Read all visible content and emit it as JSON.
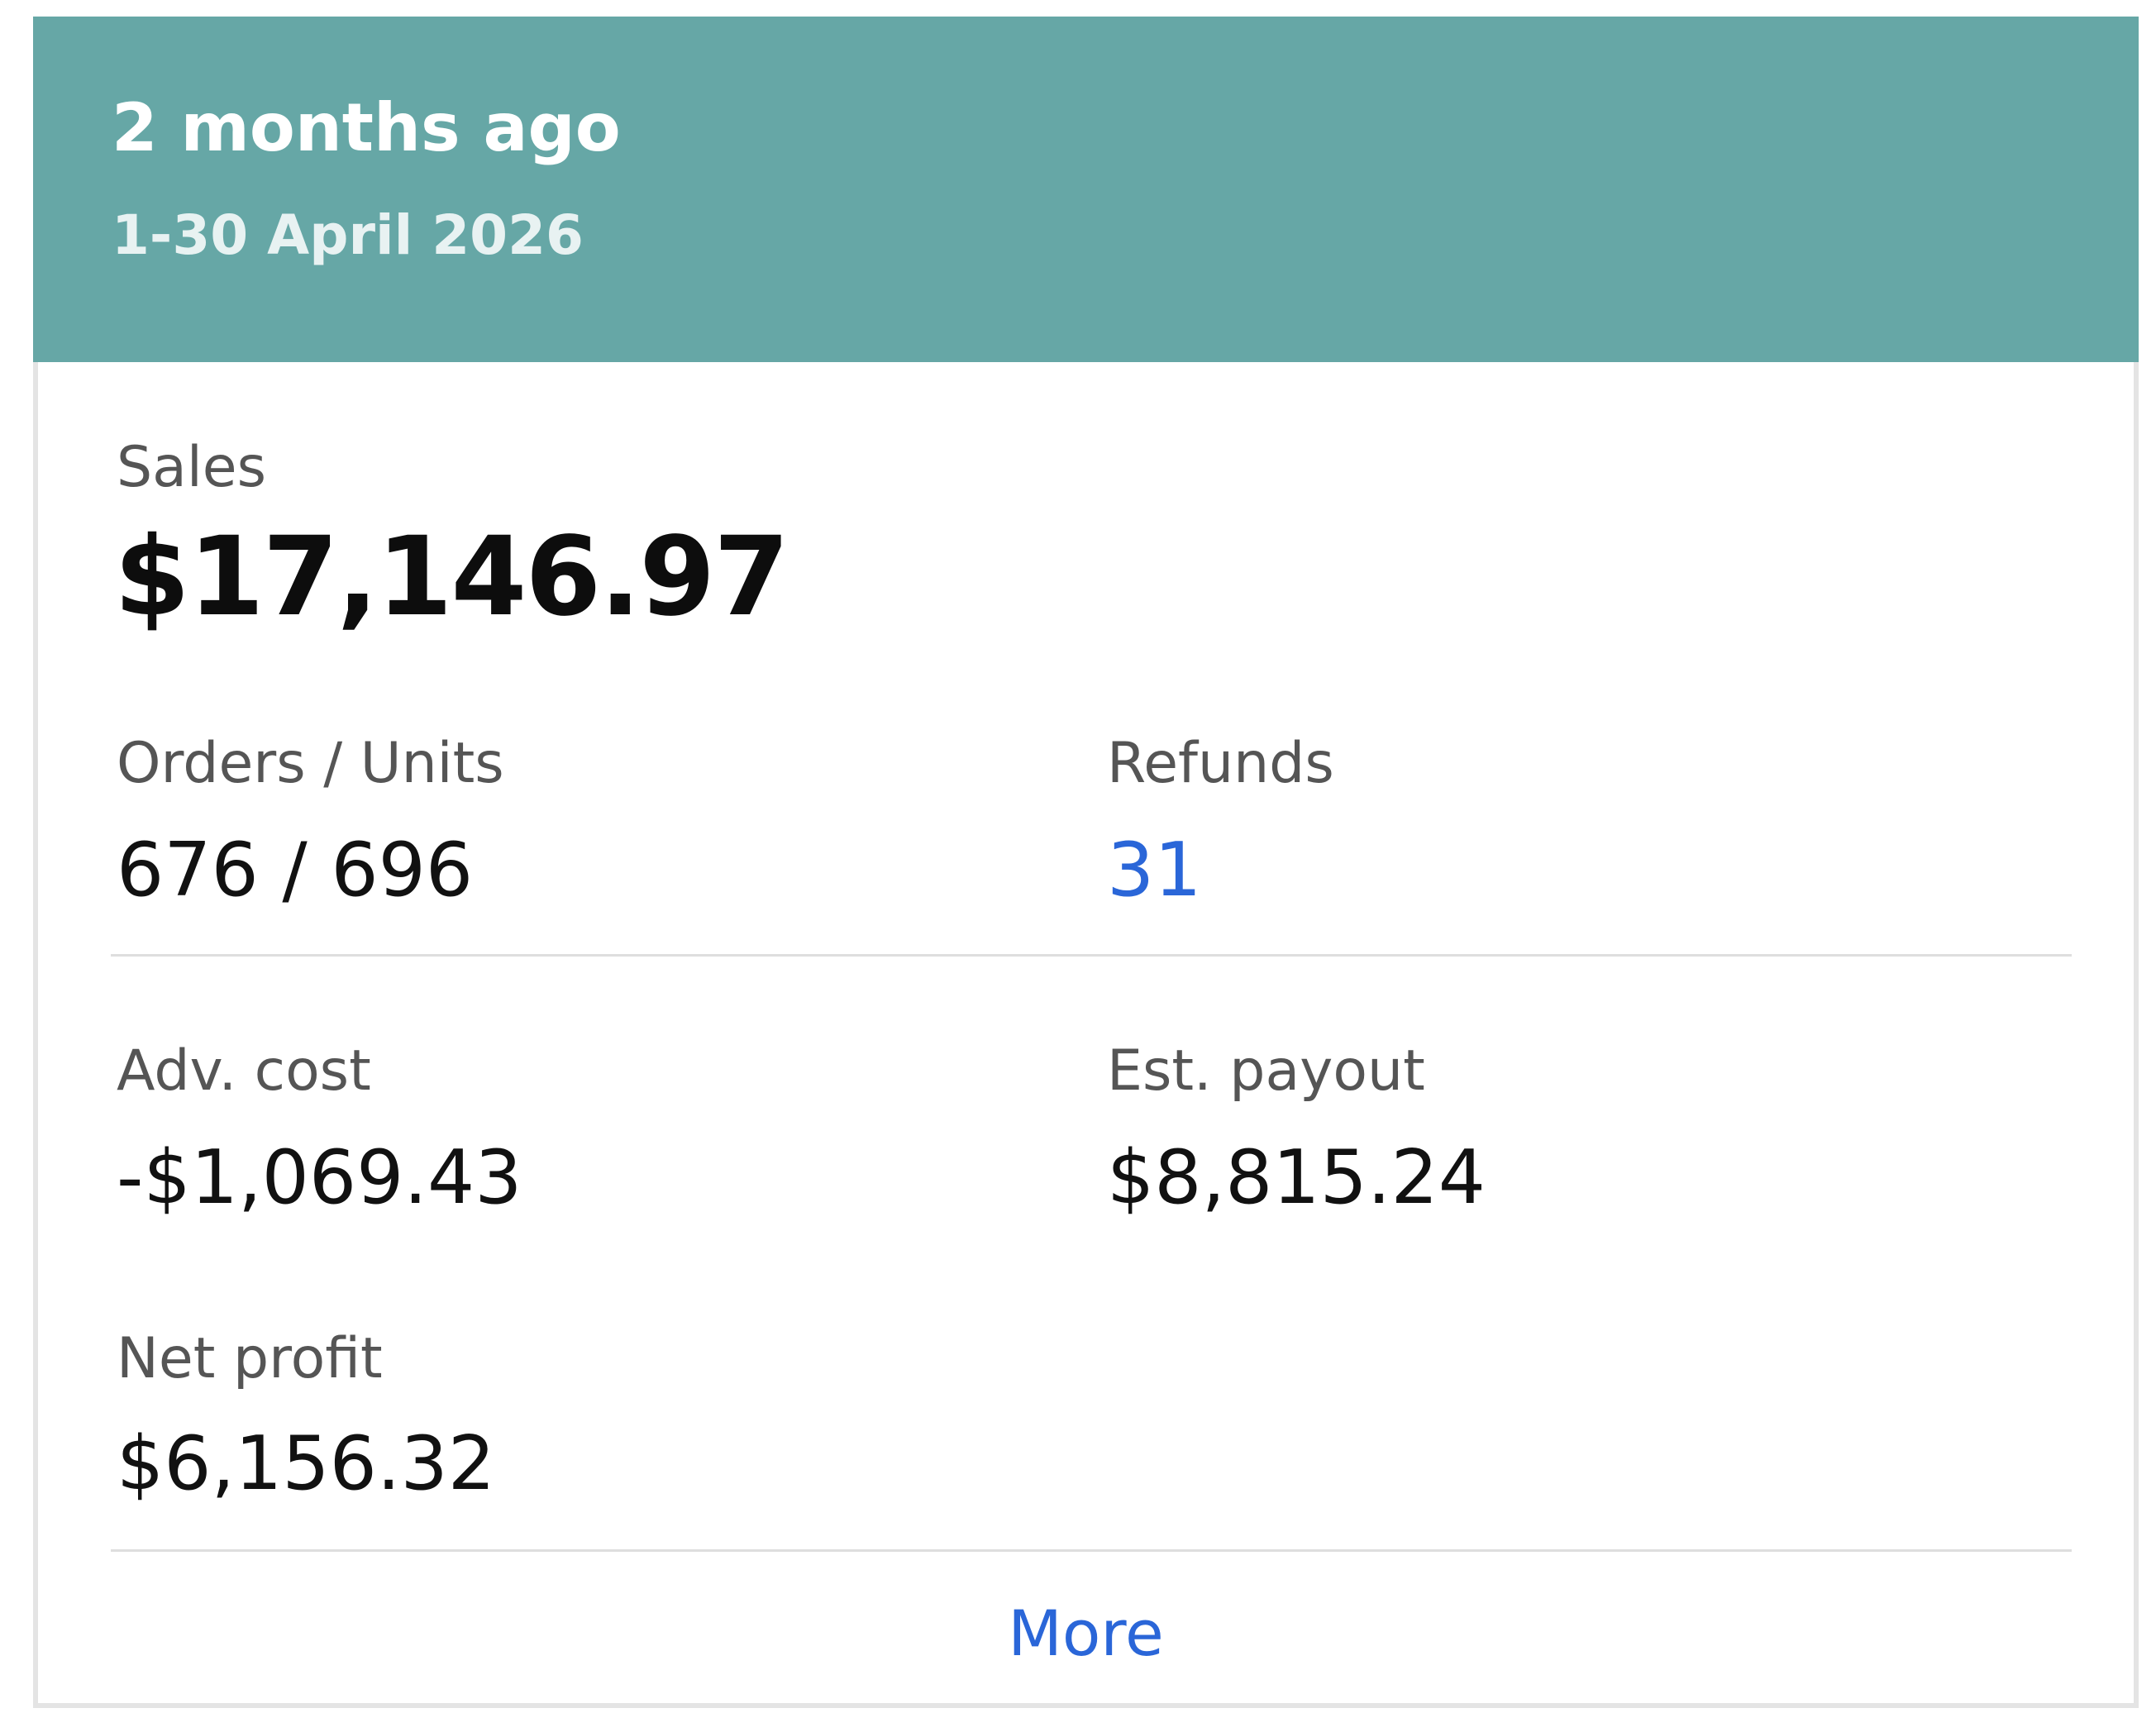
{
  "header": {
    "title": "2 months ago",
    "date_range": "1-30 April 2026",
    "background_color": "#66a7a6"
  },
  "metrics": {
    "sales": {
      "label": "Sales",
      "value": "$17,146.97"
    },
    "orders_units": {
      "label": "Orders / Units",
      "value": "676 / 696"
    },
    "refunds": {
      "label": "Refunds",
      "value": "31",
      "color": "#2a66d8"
    },
    "adv_cost": {
      "label": "Adv. cost",
      "value": "-$1,069.43"
    },
    "est_payout": {
      "label": "Est. payout",
      "value": "$8,815.24"
    },
    "net_profit": {
      "label": "Net profit",
      "value": "$6,156.32"
    }
  },
  "footer": {
    "more_label": "More",
    "link_color": "#2a66d8"
  }
}
